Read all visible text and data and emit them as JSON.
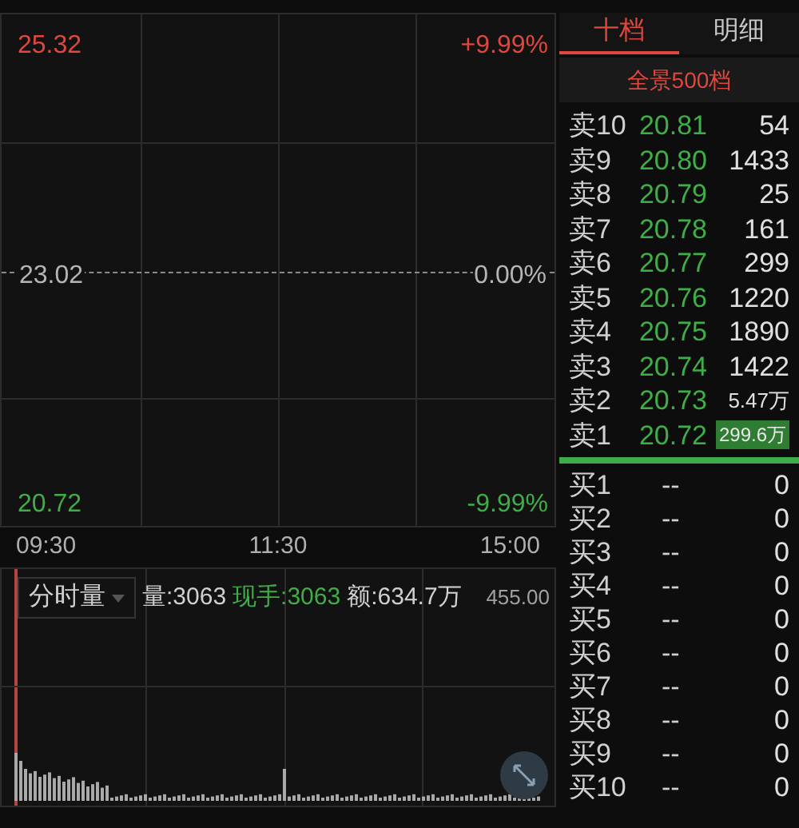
{
  "price_chart": {
    "high": "25.32",
    "high_pct": "+9.99%",
    "mid": "23.02",
    "mid_pct": "0.00%",
    "low": "20.72",
    "low_pct": "-9.99%"
  },
  "time_axis": [
    "09:30",
    "11:30",
    "15:00"
  ],
  "volume_panel": {
    "dropdown": "分时量",
    "volume": "量:3063",
    "current": "现手:3063",
    "amount": "额:634.7万",
    "max": "455.00"
  },
  "tabs": [
    {
      "label": "十档",
      "selected": true
    },
    {
      "label": "明细",
      "selected": false
    }
  ],
  "depth_button": "全景500档",
  "asks": [
    {
      "label": "卖10",
      "price": "20.81",
      "volume": "54",
      "highlighted": false
    },
    {
      "label": "卖9",
      "price": "20.80",
      "volume": "1433",
      "highlighted": false
    },
    {
      "label": "卖8",
      "price": "20.79",
      "volume": "25",
      "highlighted": false
    },
    {
      "label": "卖7",
      "price": "20.78",
      "volume": "161",
      "highlighted": false
    },
    {
      "label": "卖6",
      "price": "20.77",
      "volume": "299",
      "highlighted": false
    },
    {
      "label": "卖5",
      "price": "20.76",
      "volume": "1220",
      "highlighted": false
    },
    {
      "label": "卖4",
      "price": "20.75",
      "volume": "1890",
      "highlighted": false
    },
    {
      "label": "卖3",
      "price": "20.74",
      "volume": "1422",
      "highlighted": false
    },
    {
      "label": "卖2",
      "price": "20.73",
      "volume": "5.47万",
      "highlighted": false
    },
    {
      "label": "卖1",
      "price": "20.72",
      "volume": "299.6万",
      "highlighted": true
    }
  ],
  "bids": [
    {
      "label": "买1",
      "price": "--",
      "volume": "0"
    },
    {
      "label": "买2",
      "price": "--",
      "volume": "0"
    },
    {
      "label": "买3",
      "price": "--",
      "volume": "0"
    },
    {
      "label": "买4",
      "price": "--",
      "volume": "0"
    },
    {
      "label": "买5",
      "price": "--",
      "volume": "0"
    },
    {
      "label": "买6",
      "price": "--",
      "volume": "0"
    },
    {
      "label": "买7",
      "price": "--",
      "volume": "0"
    },
    {
      "label": "买8",
      "price": "--",
      "volume": "0"
    },
    {
      "label": "买9",
      "price": "--",
      "volume": "0"
    },
    {
      "label": "买10",
      "price": "--",
      "volume": "0"
    }
  ]
}
